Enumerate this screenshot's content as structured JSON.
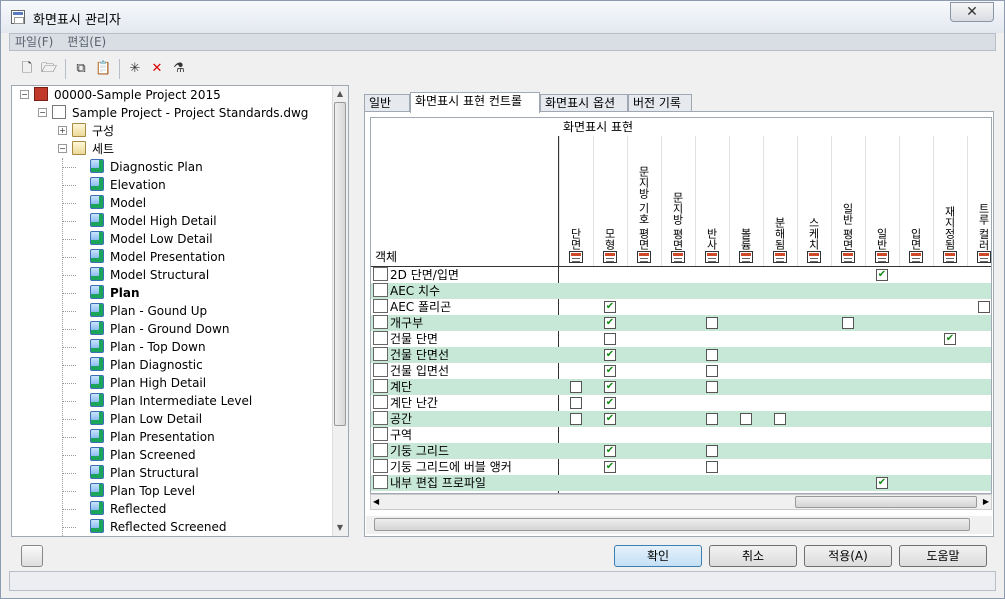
{
  "window": {
    "title": "화면표시 관리자",
    "close_glyph": "✕"
  },
  "menu": [
    "파일(F)",
    "편집(E)"
  ],
  "tree": {
    "items": [
      {
        "label": "00000-Sample Project 2015",
        "level": 0,
        "icon": "project-icon"
      },
      {
        "label": "Sample Project - Project Standards.dwg",
        "level": 1,
        "icon": "drawing-icon"
      },
      {
        "label": "구성",
        "level": 2,
        "icon": "folder-icon"
      },
      {
        "label": "세트",
        "level": 2,
        "icon": "folder-icon"
      },
      {
        "label": "Diagnostic Plan",
        "level": 3,
        "icon": "set-icon"
      },
      {
        "label": "Elevation",
        "level": 3,
        "icon": "set-icon"
      },
      {
        "label": "Model",
        "level": 3,
        "icon": "set-icon"
      },
      {
        "label": "Model High Detail",
        "level": 3,
        "icon": "set-icon"
      },
      {
        "label": "Model Low Detail",
        "level": 3,
        "icon": "set-icon"
      },
      {
        "label": "Model Presentation",
        "level": 3,
        "icon": "set-icon"
      },
      {
        "label": "Model Structural",
        "level": 3,
        "icon": "set-icon"
      },
      {
        "label": "Plan",
        "level": 3,
        "icon": "set-icon",
        "bold": true
      },
      {
        "label": "Plan - Gound Up",
        "level": 3,
        "icon": "set-icon"
      },
      {
        "label": "Plan - Ground Down",
        "level": 3,
        "icon": "set-icon"
      },
      {
        "label": "Plan - Top Down",
        "level": 3,
        "icon": "set-icon"
      },
      {
        "label": "Plan Diagnostic",
        "level": 3,
        "icon": "set-icon"
      },
      {
        "label": "Plan High Detail",
        "level": 3,
        "icon": "set-icon"
      },
      {
        "label": "Plan Intermediate Level",
        "level": 3,
        "icon": "set-icon"
      },
      {
        "label": "Plan Low Detail",
        "level": 3,
        "icon": "set-icon"
      },
      {
        "label": "Plan Presentation",
        "level": 3,
        "icon": "set-icon"
      },
      {
        "label": "Plan Screened",
        "level": 3,
        "icon": "set-icon"
      },
      {
        "label": "Plan Structural",
        "level": 3,
        "icon": "set-icon"
      },
      {
        "label": "Plan Top Level",
        "level": 3,
        "icon": "set-icon"
      },
      {
        "label": "Reflected",
        "level": 3,
        "icon": "set-icon"
      },
      {
        "label": "Reflected Screened",
        "level": 3,
        "icon": "set-icon"
      }
    ]
  },
  "tabs": [
    "일반",
    "화면표시 표현 컨트롤",
    "화면표시 옵션",
    "버전 기록"
  ],
  "active_tab": 1,
  "grid": {
    "band_label": "화면표시 표현",
    "object_header": "객체",
    "columns": [
      "단면",
      "모형",
      "문지방 기호 평면",
      "문지방 평면",
      "반사",
      "볼륨",
      "분해됨",
      "스케치",
      "일반 평면",
      "일반",
      "입면",
      "재지정됨",
      "트루 컬러"
    ],
    "rows": [
      {
        "label": "2D 단면/입면",
        "cells": [
          "",
          "",
          "",
          "",
          "",
          "",
          "",
          "",
          "",
          "c",
          "",
          "",
          ""
        ]
      },
      {
        "label": "AEC 치수",
        "cells": [
          "",
          "",
          "",
          "",
          "",
          "",
          "",
          "",
          "",
          "",
          "",
          "",
          ""
        ]
      },
      {
        "label": "AEC 폴리곤",
        "cells": [
          "",
          "c",
          "",
          "",
          "",
          "",
          "",
          "",
          "",
          "",
          "",
          "",
          "u"
        ]
      },
      {
        "label": "개구부",
        "cells": [
          "",
          "c",
          "",
          "",
          "u",
          "",
          "",
          "",
          "u",
          "",
          "",
          "",
          ""
        ]
      },
      {
        "label": "건물 단면",
        "cells": [
          "",
          "u",
          "",
          "",
          "",
          "",
          "",
          "",
          "",
          "",
          "",
          "c",
          ""
        ]
      },
      {
        "label": "건물 단면선",
        "cells": [
          "",
          "c",
          "",
          "",
          "u",
          "",
          "",
          "",
          "",
          "",
          "",
          "",
          ""
        ]
      },
      {
        "label": "건물 입면선",
        "cells": [
          "",
          "c",
          "",
          "",
          "u",
          "",
          "",
          "",
          "",
          "",
          "",
          "",
          ""
        ]
      },
      {
        "label": "계단",
        "cells": [
          "u",
          "c",
          "",
          "",
          "u",
          "",
          "",
          "",
          "",
          "",
          "",
          "",
          ""
        ]
      },
      {
        "label": "계단 난간",
        "cells": [
          "u",
          "c",
          "",
          "",
          "",
          "",
          "",
          "",
          "",
          "",
          "",
          "",
          ""
        ]
      },
      {
        "label": "공간",
        "cells": [
          "u",
          "c",
          "",
          "",
          "u",
          "u",
          "u",
          "",
          "",
          "",
          "",
          "",
          ""
        ]
      },
      {
        "label": "구역",
        "cells": [
          "",
          "",
          "",
          "",
          "",
          "",
          "",
          "",
          "",
          "",
          "",
          "",
          ""
        ]
      },
      {
        "label": "기둥 그리드",
        "cells": [
          "",
          "c",
          "",
          "",
          "u",
          "",
          "",
          "",
          "",
          "",
          "",
          "",
          ""
        ]
      },
      {
        "label": "기둥 그리드에 버블 앵커",
        "cells": [
          "",
          "c",
          "",
          "",
          "u",
          "",
          "",
          "",
          "",
          "",
          "",
          "",
          ""
        ]
      },
      {
        "label": "내부 편집 프로파일",
        "cells": [
          "",
          "",
          "",
          "",
          "",
          "",
          "",
          "",
          "",
          "c",
          "",
          "",
          ""
        ]
      }
    ]
  },
  "buttons": {
    "ok": "확인",
    "cancel": "취소",
    "apply": "적용(A)",
    "help": "도움말"
  }
}
